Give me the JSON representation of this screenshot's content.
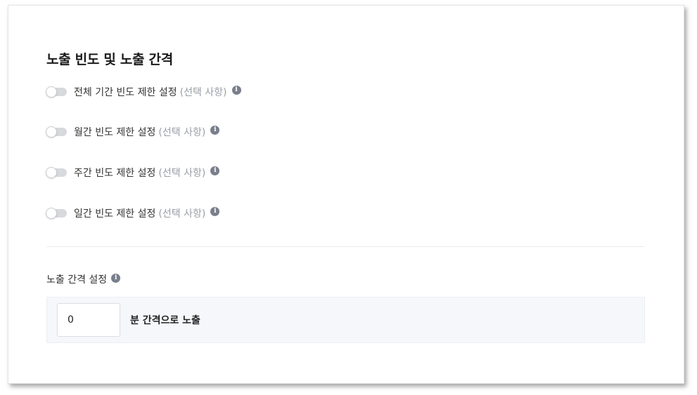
{
  "section": {
    "title": "노출 빈도 및 노출 간격"
  },
  "toggles": [
    {
      "label": "전체 기간 빈도 제한 설정",
      "optional": "(선택 사항)",
      "enabled": false
    },
    {
      "label": "월간 빈도 제한 설정",
      "optional": "(선택 사항)",
      "enabled": false
    },
    {
      "label": "주간 빈도 제한 설정",
      "optional": "(선택 사항)",
      "enabled": false
    },
    {
      "label": "일간 빈도 제한 설정",
      "optional": "(선택 사항)",
      "enabled": false
    }
  ],
  "interval": {
    "label": "노출 간격 설정",
    "value": "0",
    "suffix": "분 간격으로 노출"
  },
  "icons": {
    "info": "info-icon",
    "info_glyph": "i"
  },
  "colors": {
    "toggle_off": "#d7d9dd",
    "info_icon": "#7a7f8c",
    "optional_text": "#9a9ea6",
    "interval_bg": "#f6f7fb"
  }
}
